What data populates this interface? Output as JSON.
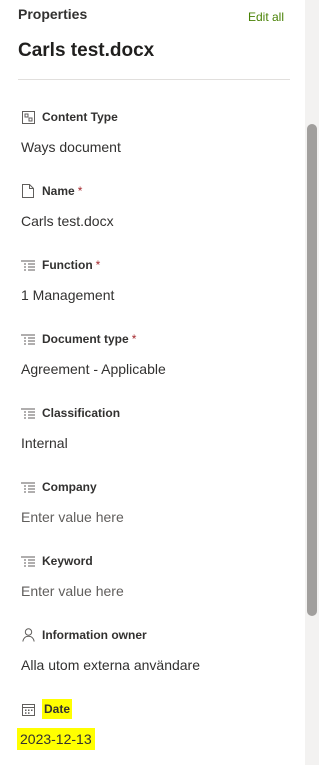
{
  "header": {
    "section_title": "Properties",
    "edit_all": "Edit all",
    "file_name": "Carls test.docx"
  },
  "fields": [
    {
      "label": "Content Type",
      "required": false,
      "value": "Ways document",
      "icon": "content-type-icon"
    },
    {
      "label": "Name",
      "required": true,
      "value": "Carls test.docx",
      "icon": "document-icon"
    },
    {
      "label": "Function",
      "required": true,
      "value": "1 Management",
      "icon": "choice-list-icon"
    },
    {
      "label": "Document type",
      "required": true,
      "value": "Agreement - Applicable",
      "icon": "choice-list-icon"
    },
    {
      "label": "Classification",
      "required": false,
      "value": "Internal",
      "icon": "choice-list-icon"
    },
    {
      "label": "Company",
      "required": false,
      "placeholder": "Enter value here",
      "icon": "choice-list-icon"
    },
    {
      "label": "Keyword",
      "required": false,
      "placeholder": "Enter value here",
      "icon": "choice-list-icon"
    },
    {
      "label": "Information owner",
      "required": false,
      "value": "Alla utom externa användare",
      "icon": "person-icon"
    },
    {
      "label": "Date",
      "required": false,
      "value": "2023-12-13",
      "icon": "calendar-icon",
      "highlighted": true
    }
  ],
  "required_marker": "*",
  "colors": {
    "accent_link": "#498205",
    "required": "#a4262c",
    "highlight": "#ffff00",
    "scrollbar_thumb": "#a19f9d"
  }
}
